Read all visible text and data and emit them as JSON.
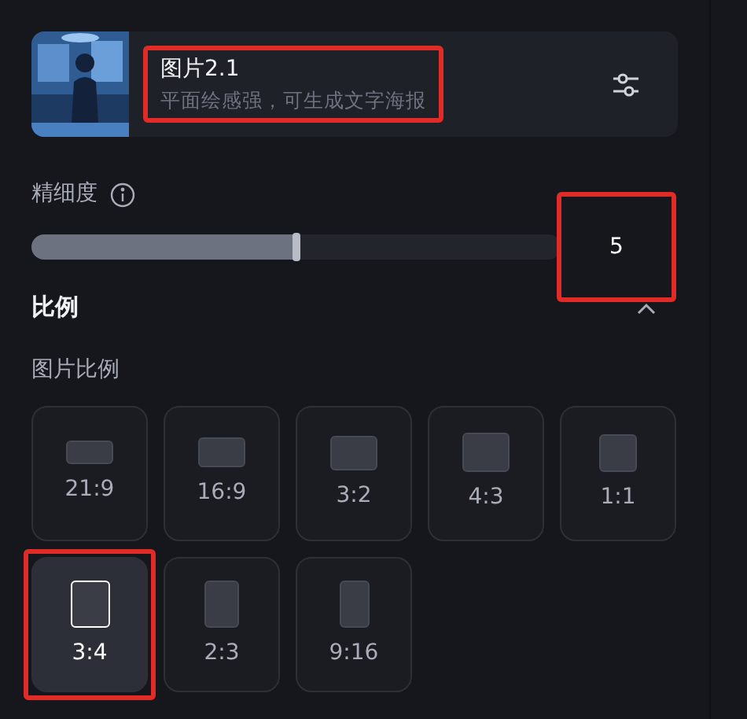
{
  "model": {
    "title": "图片2.1",
    "subtitle": "平面绘感强，可生成文字海报",
    "highlighted": true
  },
  "detail": {
    "label": "精细度",
    "level": 0.5,
    "value": "5",
    "highlighted": true
  },
  "ratio_section": {
    "title": "比例",
    "expanded": true,
    "subtitle": "图片比例",
    "options": [
      {
        "label": "21:9",
        "selected": false,
        "highlighted": false
      },
      {
        "label": "16:9",
        "selected": false,
        "highlighted": false
      },
      {
        "label": "3:2",
        "selected": false,
        "highlighted": false
      },
      {
        "label": "4:3",
        "selected": false,
        "highlighted": false
      },
      {
        "label": "1:1",
        "selected": false,
        "highlighted": false
      },
      {
        "label": "3:4",
        "selected": true,
        "highlighted": true
      },
      {
        "label": "2:3",
        "selected": false,
        "highlighted": false
      },
      {
        "label": "9:16",
        "selected": false,
        "highlighted": false
      }
    ]
  }
}
